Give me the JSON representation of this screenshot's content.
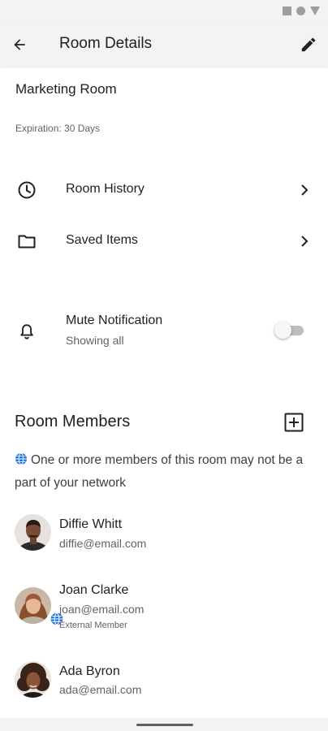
{
  "app_bar": {
    "title": "Room Details",
    "back_icon": "arrow-back-icon",
    "edit_icon": "pencil-icon"
  },
  "room": {
    "name": "Marketing Room",
    "expiration": "Expiration: 30 Days"
  },
  "menu": {
    "history": {
      "label": "Room History",
      "icon": "clock-icon"
    },
    "saved": {
      "label": "Saved Items",
      "icon": "folder-icon"
    }
  },
  "mute": {
    "label": "Mute Notification",
    "subtitle": "Showing all",
    "icon": "bell-icon",
    "enabled": false
  },
  "members_section": {
    "title": "Room Members",
    "add_icon": "add-box-icon",
    "network_note": "One or more members of this room may not be a part of your network"
  },
  "members": [
    {
      "name": "Diffie Whitt",
      "email": "diffie@email.com",
      "external": false
    },
    {
      "name": "Joan Clarke",
      "email": "joan@email.com",
      "tag": "External Member",
      "external": true
    },
    {
      "name": "Ada Byron",
      "email": "ada@email.com",
      "external": false
    }
  ],
  "colors": {
    "bar_background": "#f3f3f3",
    "globe_blue": "#1a73e8",
    "text_primary": "#202124",
    "text_secondary": "#5f6368"
  }
}
